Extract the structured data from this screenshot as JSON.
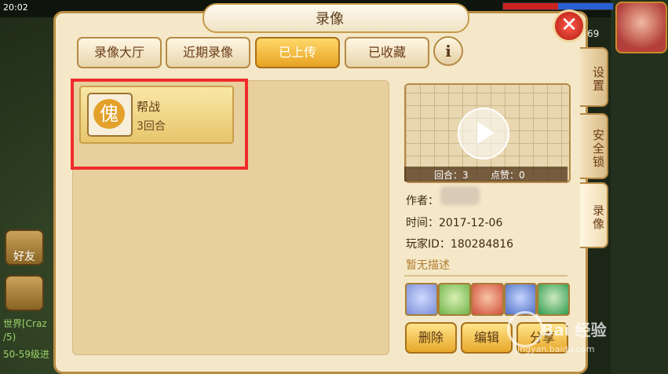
{
  "status": {
    "time": "20:02",
    "level": "69"
  },
  "left_ui": {
    "friends_label": "好友",
    "chat_lines": [
      "世界[Craz",
      "/5)",
      "50-59级进"
    ]
  },
  "panel": {
    "title": "录像",
    "close_icon": "close-icon",
    "tabs": [
      {
        "label": "录像大厅",
        "active": false
      },
      {
        "label": "近期录像",
        "active": false
      },
      {
        "label": "已上传",
        "active": true
      },
      {
        "label": "已收藏",
        "active": false
      }
    ],
    "info_label": "i",
    "side_tabs": [
      {
        "label": "设置"
      },
      {
        "label": "安全锁"
      },
      {
        "label": "录像"
      }
    ]
  },
  "recordings": [
    {
      "title": "帮战",
      "rounds": "3回合",
      "icon_char": "傀"
    }
  ],
  "detail": {
    "rounds_label": "回合：3",
    "likes_label": "点赞：0",
    "author_label": "作者：",
    "time_label": "时间：2017-12-06",
    "player_id_label": "玩家ID：180284816",
    "description": "暂无描述",
    "avatars": [
      {
        "name": "avatar-1",
        "color": "#7a8ed6"
      },
      {
        "name": "avatar-2",
        "color": "#6fb24a"
      },
      {
        "name": "avatar-3",
        "color": "#d24f3b"
      },
      {
        "name": "avatar-4",
        "color": "#4d6fc2"
      },
      {
        "name": "avatar-5",
        "color": "#2f9b4e"
      }
    ],
    "delete_label": "删除",
    "edit_label": "编辑",
    "share_label": "分享"
  },
  "watermark": {
    "text": "Bai 经验",
    "url": "jingyan.baidu.com"
  },
  "colors": {
    "accent": "#e7a322",
    "highlight": "#f02b2b"
  }
}
